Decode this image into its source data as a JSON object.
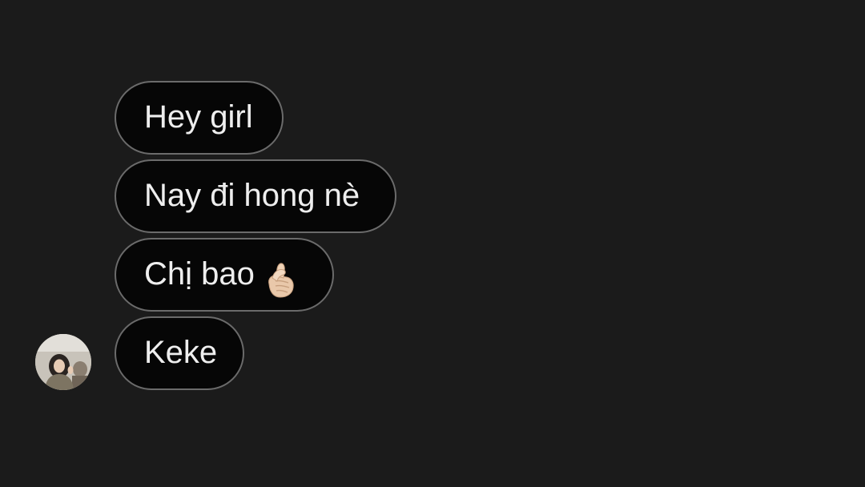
{
  "conversation": {
    "messages": [
      {
        "text": "Hey girl"
      },
      {
        "text": "Nay đi hong nè"
      },
      {
        "text": "Chị bao",
        "emoji": "finger-heart-emoji"
      },
      {
        "text": "Keke"
      }
    ],
    "avatar": {
      "icon": "contact-avatar-photo"
    }
  },
  "colors": {
    "background": "#1b1b1b",
    "bubble_fill": "#060606",
    "bubble_border": "#6b6b6b",
    "text": "#eeeeee",
    "emoji_skin": "#e7c3a3"
  }
}
